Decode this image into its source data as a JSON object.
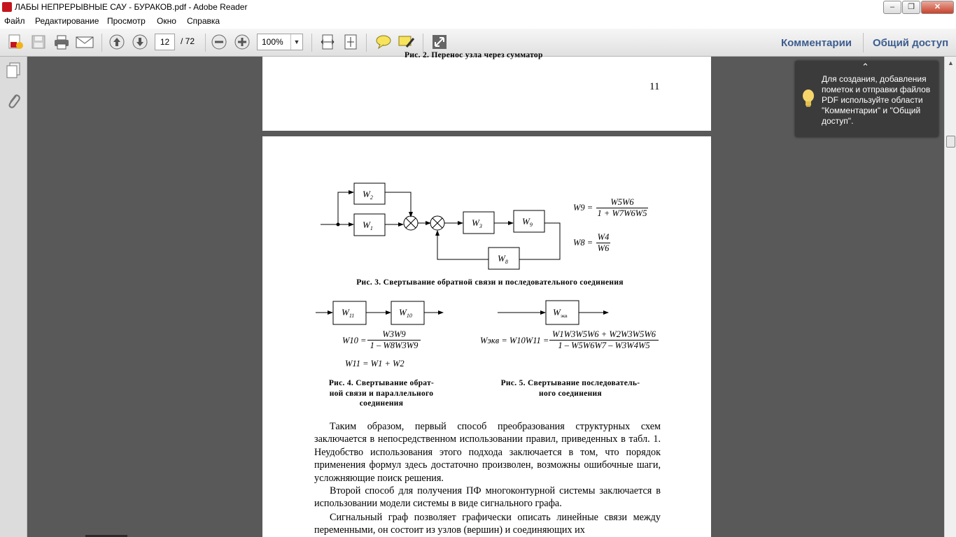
{
  "window": {
    "title": "ЛАБЫ НЕПРЕРЫВНЫЕ САУ - БУРАКОВ.pdf - Adobe Reader",
    "minimize": "–",
    "maximize": "❐",
    "close": "✕"
  },
  "menu": [
    "Файл",
    "Редактирование",
    "Просмотр",
    "Окно",
    "Справка"
  ],
  "toolbar": {
    "page_current": "12",
    "page_total": "/ 72",
    "zoom": "100%",
    "comments_label": "Комментарии",
    "share_label": "Общий доступ"
  },
  "tooltip": {
    "text": "Для создания, добавления пометок и отправки файлов PDF используйте области \"Комментарии\" и \"Общий доступ\"."
  },
  "page_prev": {
    "caption_partial": "Рис. 2. Перенос узла через сумматор",
    "page_number": "11"
  },
  "page_current": {
    "fig3": {
      "blocks": [
        "W2",
        "W1",
        "W3",
        "W9",
        "W8"
      ],
      "formula_w9_lhs": "W9 =",
      "formula_w9_num": "W5W6",
      "formula_w9_den": "1 + W7W6W5",
      "formula_w8_lhs": "W8 =",
      "formula_w8_num": "W4",
      "formula_w8_den": "W6",
      "caption": "Рис. 3. Свертывание обратной связи и последовательного соединения"
    },
    "fig4": {
      "blocks": [
        "W11",
        "W10"
      ],
      "formula_w10_lhs": "W10 =",
      "formula_w10_num": "W3W9",
      "formula_w10_den": "1 – W8W3W9",
      "formula_w11": "W11 = W1 + W2",
      "caption_lines": [
        "Рис. 4. Свертывание обрат-",
        "ной связи и параллельного",
        "соединения"
      ]
    },
    "fig5": {
      "block": "Wэкв",
      "formula_lhs": "Wэкв = W10W11 =",
      "formula_num": "W1W3W5W6 + W2W3W5W6",
      "formula_den": "1 – W5W6W7 – W3W4W5",
      "caption_lines": [
        "Рис. 5. Свертывание последователь-",
        "ного соединения"
      ]
    },
    "paragraphs": [
      "Таким образом, первый способ преобразования структурных схем заключается в непосредственном использовании правил, приведенных в табл. 1. Неудобство использования этого подхода заключается в том, что порядок применения формул здесь достаточно произволен, возможны ошибочные шаги, усложняющие поиск решения.",
      "Второй способ для получения ПФ многоконтурной системы заключается в использовании модели системы в виде сигнального графа.",
      "Сигнальный граф позволяет графически описать линейные связи между переменными, он состоит из узлов (вершин) и соединяющих их"
    ]
  },
  "colors": {
    "workspace": "#595959",
    "link": "#3c5d8f",
    "tooltip_bg": "#3b3b3b"
  }
}
